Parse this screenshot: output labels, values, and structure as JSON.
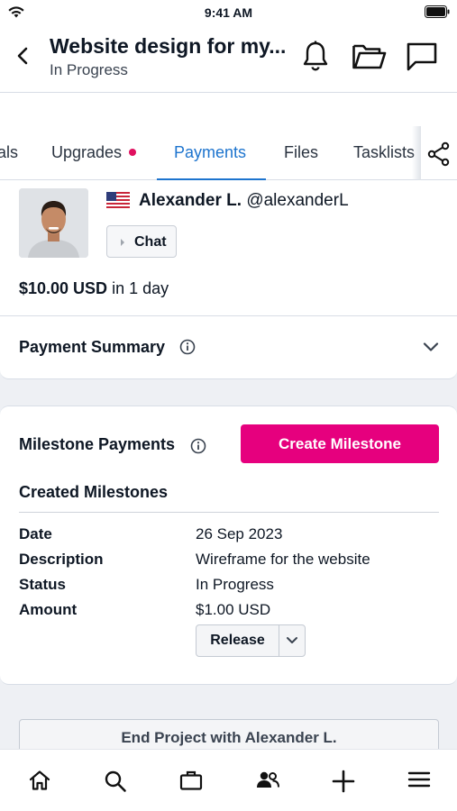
{
  "status_bar": {
    "time": "9:41 AM"
  },
  "header": {
    "title": "Website design for my...",
    "status": "In Progress"
  },
  "tabs": [
    {
      "label": "als"
    },
    {
      "label": "Upgrades"
    },
    {
      "label": "Payments"
    },
    {
      "label": "Files"
    },
    {
      "label": "Tasklists"
    }
  ],
  "freelancer": {
    "name": "Alexander L.",
    "handle": "@alexanderL",
    "chat_label": "Chat",
    "amount": "$10.00 USD",
    "timeframe": "in 1 day"
  },
  "payment_summary": {
    "label": "Payment Summary"
  },
  "milestones": {
    "section_label": "Milestone Payments",
    "create_label": "Create Milestone",
    "created_label": "Created Milestones",
    "rows": [
      {
        "key": "Date",
        "value": "26 Sep 2023"
      },
      {
        "key": "Description",
        "value": "Wireframe for the website"
      },
      {
        "key": "Status",
        "value": "In Progress"
      },
      {
        "key": "Amount",
        "value": "$1.00 USD"
      }
    ],
    "release_label": "Release"
  },
  "end_project_label": "End Project with Alexander L.",
  "colors": {
    "accent": "#1d74ce",
    "brand": "#e6007e",
    "notification_dot": "#e0105f"
  },
  "icons": {
    "header": [
      "chevron-left-icon",
      "bell-icon",
      "folder-icon",
      "chat-icon"
    ],
    "tabs": [
      "share-icon"
    ],
    "bottom_nav": [
      "home-icon",
      "search-icon",
      "briefcase-icon",
      "people-icon",
      "plus-icon",
      "menu-icon"
    ]
  }
}
